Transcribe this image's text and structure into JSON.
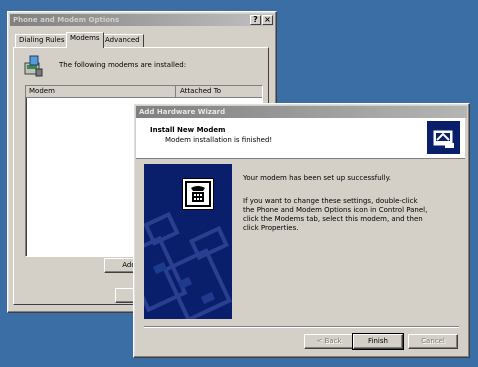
{
  "phone_modem_window": {
    "title": "Phone and Modem Options",
    "help_button": "?",
    "close_button": "×",
    "tabs": [
      {
        "label": "Dialing Rules"
      },
      {
        "label": "Modems"
      },
      {
        "label": "Advanced"
      }
    ],
    "intro_text": "The following modems are  installed:",
    "list_headers": {
      "modem": "Modem",
      "attached_to": "Attached To"
    },
    "add_button": "Add"
  },
  "wizard": {
    "title": "Add Hardware Wizard",
    "header_title": "Install New Modem",
    "header_subtitle": "Modem installation is finished!",
    "message1": "Your modem has been set up successfully.",
    "message2": "If you want to change these settings, double-click the Phone and Modem Options icon in Control Panel, click the Modems tab, select this modem, and then click Properties.",
    "back_button": "< Back",
    "finish_button": "Finish",
    "cancel_button": "Cancel"
  },
  "colors": {
    "desktop": "#3a6ea5",
    "panel": "#0a1f6b"
  },
  "icons": [
    "phone-modem-icon",
    "header-modem-icon",
    "telephone-icon"
  ]
}
